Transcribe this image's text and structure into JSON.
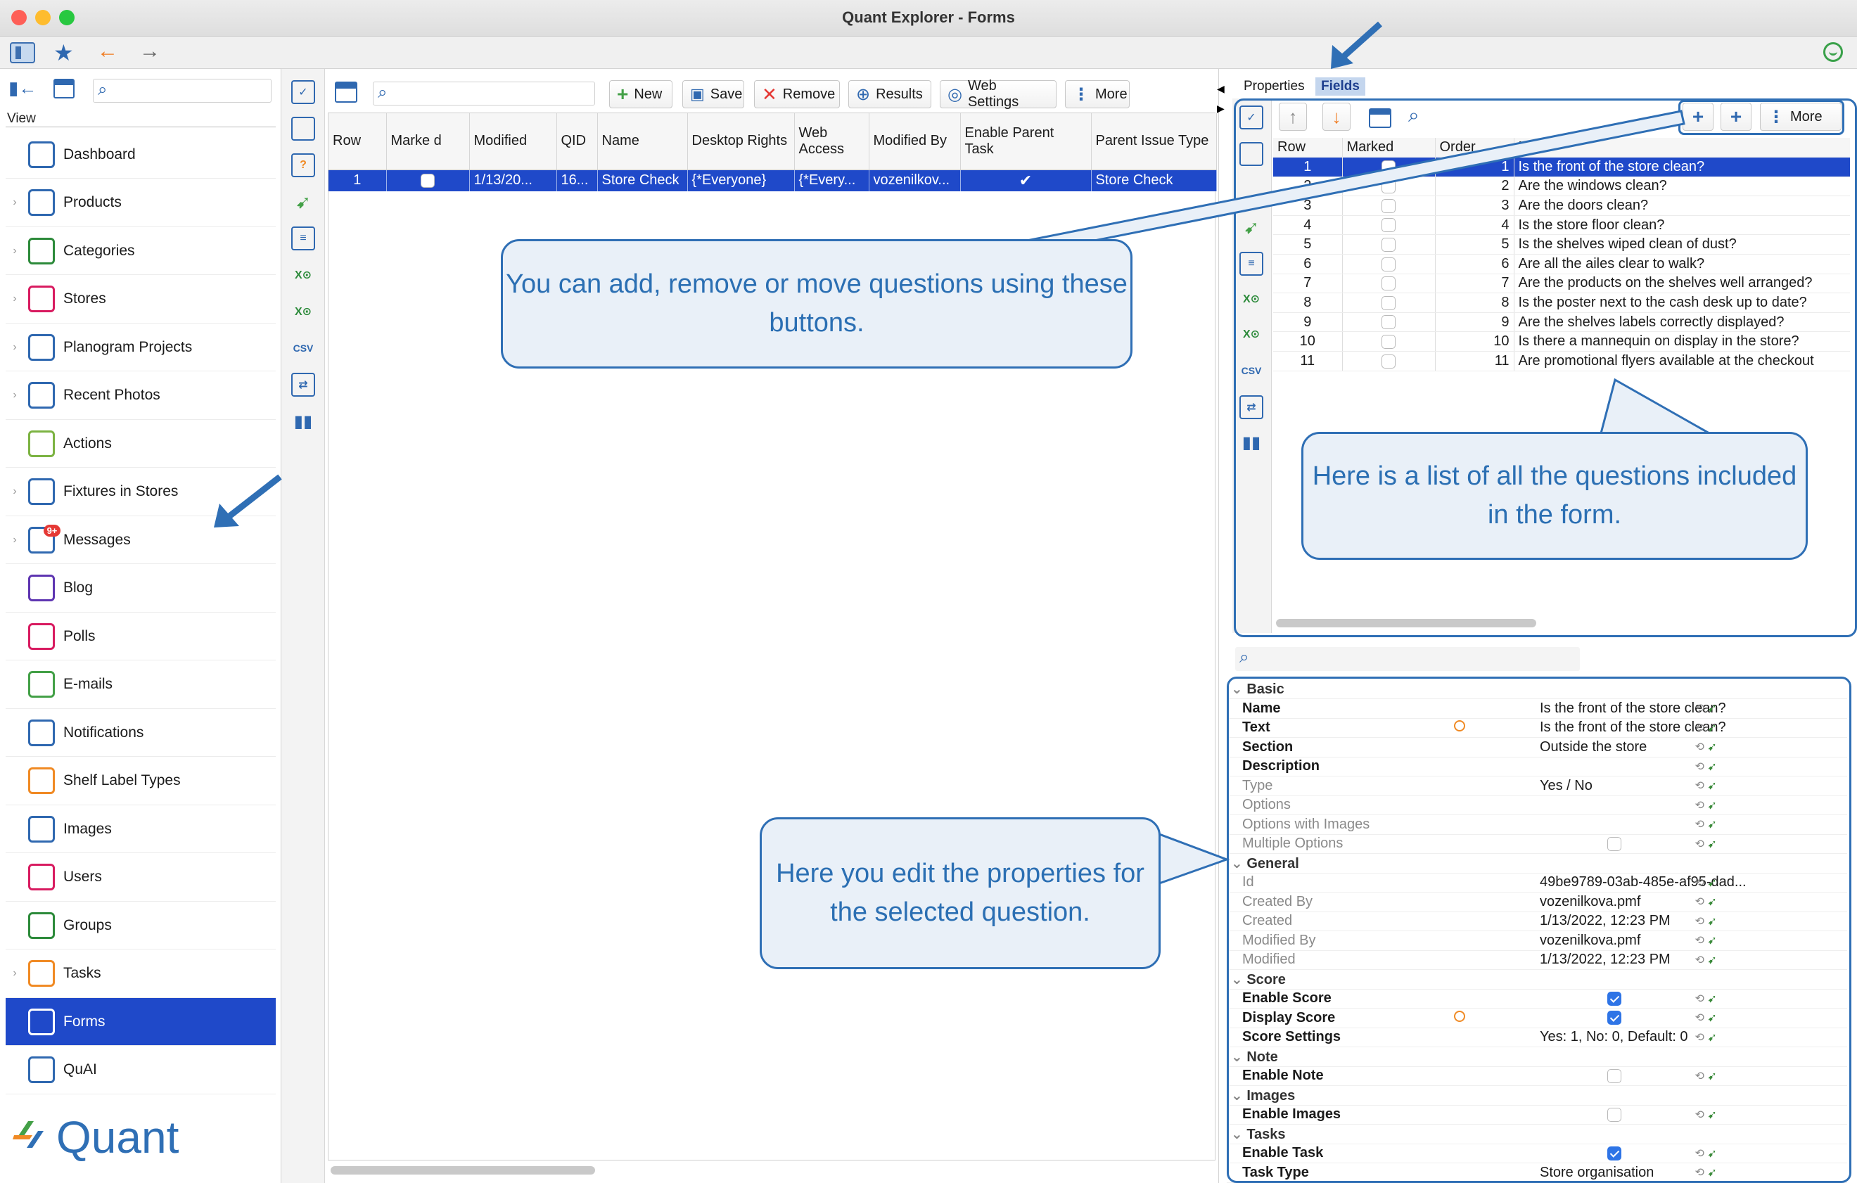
{
  "window": {
    "title": "Quant Explorer - Forms"
  },
  "sidebar": {
    "view_label": "View",
    "items": [
      {
        "label": "Dashboard",
        "expandable": false,
        "icon": "dashboard-icon"
      },
      {
        "label": "Products",
        "expandable": true,
        "icon": "products-icon"
      },
      {
        "label": "Categories",
        "expandable": true,
        "icon": "categories-icon"
      },
      {
        "label": "Stores",
        "expandable": true,
        "icon": "stores-icon"
      },
      {
        "label": "Planogram Projects",
        "expandable": true,
        "icon": "planogram-icon"
      },
      {
        "label": "Recent Photos",
        "expandable": true,
        "icon": "camera-icon"
      },
      {
        "label": "Actions",
        "expandable": false,
        "icon": "actions-icon"
      },
      {
        "label": "Fixtures in Stores",
        "expandable": true,
        "icon": "fixtures-icon"
      },
      {
        "label": "Messages",
        "expandable": true,
        "icon": "messages-icon",
        "badge": "9+"
      },
      {
        "label": "Blog",
        "expandable": false,
        "icon": "blog-icon"
      },
      {
        "label": "Polls",
        "expandable": false,
        "icon": "polls-icon"
      },
      {
        "label": "E-mails",
        "expandable": false,
        "icon": "email-icon"
      },
      {
        "label": "Notifications",
        "expandable": false,
        "icon": "notifications-icon"
      },
      {
        "label": "Shelf Label Types",
        "expandable": false,
        "icon": "shelf-label-icon"
      },
      {
        "label": "Images",
        "expandable": false,
        "icon": "images-icon"
      },
      {
        "label": "Users",
        "expandable": false,
        "icon": "users-icon"
      },
      {
        "label": "Groups",
        "expandable": false,
        "icon": "groups-icon"
      },
      {
        "label": "Tasks",
        "expandable": true,
        "icon": "tasks-icon"
      },
      {
        "label": "Forms",
        "expandable": false,
        "icon": "forms-icon",
        "selected": true
      },
      {
        "label": "QuAI",
        "expandable": false,
        "icon": "quai-icon"
      }
    ],
    "logo_text": "Quant"
  },
  "toolbar": {
    "new": "New",
    "save": "Save",
    "remove": "Remove",
    "results": "Results",
    "web_settings": "Web Settings",
    "more": "More"
  },
  "forms_table": {
    "headers": [
      "Row",
      "Marke d",
      "Modified",
      "QID",
      "Name",
      "Desktop Rights",
      "Web Access",
      "Modified By",
      "Enable Parent Task",
      "Parent Issue Type"
    ],
    "sort_indicator": "1",
    "rows": [
      {
        "row": "1",
        "modified": "1/13/20...",
        "qid": "16...",
        "name": "Store Check",
        "desktop_rights": "{*Everyone}",
        "web_access": "{*Every...",
        "modified_by": "vozenilkov...",
        "parent_issue_type": "Store Check"
      }
    ]
  },
  "right_tabs": {
    "properties": "Properties",
    "fields": "Fields"
  },
  "fields_toolbar": {
    "more": "More"
  },
  "fields_table": {
    "headers": [
      "Row",
      "Marked",
      "Order",
      "Na..."
    ],
    "rows": [
      {
        "row": "1",
        "order": "1",
        "name": "Is the front of the store clean?"
      },
      {
        "row": "2",
        "order": "2",
        "name": "Are the windows clean?"
      },
      {
        "row": "3",
        "order": "3",
        "name": "Are the doors clean?"
      },
      {
        "row": "4",
        "order": "4",
        "name": "Is the store floor clean?"
      },
      {
        "row": "5",
        "order": "5",
        "name": "Is the shelves wiped clean of dust?"
      },
      {
        "row": "6",
        "order": "6",
        "name": "Are all the ailes clear to walk?"
      },
      {
        "row": "7",
        "order": "7",
        "name": "Are the products on the shelves well arranged?"
      },
      {
        "row": "8",
        "order": "8",
        "name": "Is the poster next to the cash desk up to date?"
      },
      {
        "row": "9",
        "order": "9",
        "name": "Are the shelves labels correctly displayed?"
      },
      {
        "row": "10",
        "order": "10",
        "name": "Is there a mannequin on display in the store?"
      },
      {
        "row": "11",
        "order": "11",
        "name": "Are promotional flyers available at the checkout"
      }
    ]
  },
  "properties": [
    {
      "section": "Basic"
    },
    {
      "key": "Name",
      "value": "Is the front of the store clean?"
    },
    {
      "key": "Text",
      "value": "Is the front of the store clean?",
      "alert": true
    },
    {
      "key": "Section",
      "value": "Outside the store"
    },
    {
      "key": "Description",
      "value": ""
    },
    {
      "key": "Type",
      "value": "Yes / No",
      "dim": true
    },
    {
      "key": "Options",
      "value": "",
      "dim": true
    },
    {
      "key": "Options with Images",
      "value": "",
      "dim": true
    },
    {
      "key": "Multiple Options",
      "value": "",
      "dim": true,
      "check": "off"
    },
    {
      "section": "General"
    },
    {
      "key": "Id",
      "value": "49be9789-03ab-485e-af95-dad...",
      "dim": true
    },
    {
      "key": "Created By",
      "value": "vozenilkova.pmf",
      "dim": true
    },
    {
      "key": "Created",
      "value": "1/13/2022, 12:23 PM",
      "dim": true
    },
    {
      "key": "Modified By",
      "value": "vozenilkova.pmf",
      "dim": true
    },
    {
      "key": "Modified",
      "value": "1/13/2022, 12:23 PM",
      "dim": true
    },
    {
      "section": "Score"
    },
    {
      "key": "Enable Score",
      "value": "",
      "check": "on"
    },
    {
      "key": "Display Score",
      "value": "",
      "check": "on",
      "alert": true
    },
    {
      "key": "Score Settings",
      "value": "Yes: 1, No: 0, Default: 0"
    },
    {
      "section": "Note"
    },
    {
      "key": "Enable Note",
      "value": "",
      "check": "off"
    },
    {
      "section": "Images"
    },
    {
      "key": "Enable Images",
      "value": "",
      "check": "off"
    },
    {
      "section": "Tasks"
    },
    {
      "key": "Enable Task",
      "value": "",
      "check": "on"
    },
    {
      "key": "Task Type",
      "value": "Store organisation"
    }
  ],
  "callouts": {
    "buttons": "You can add, remove or move questions using these buttons.",
    "list": "Here is a list of all the questions included in the form.",
    "properties": "Here you edit the properties for the selected question."
  },
  "colors": {
    "accent": "#1f49c9",
    "callout_border": "#2f6fb5",
    "callout_fill": "#e9f0f8",
    "callout_text": "#2b6fb3",
    "arrow": "#2f6fb5"
  }
}
